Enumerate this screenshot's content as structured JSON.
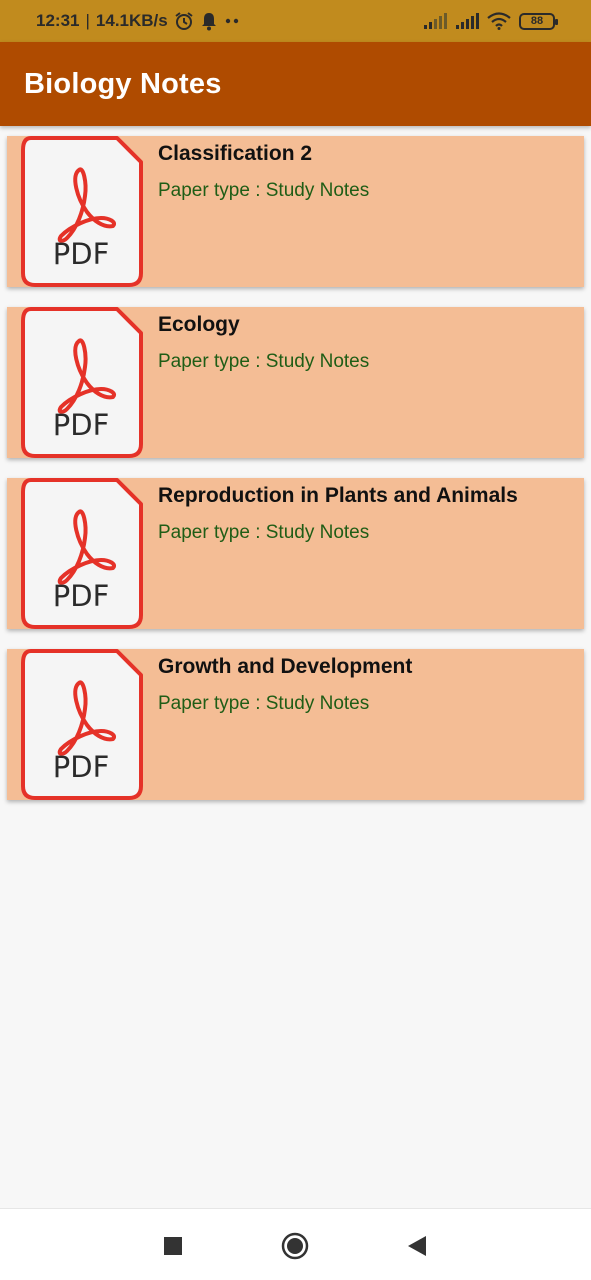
{
  "status_bar": {
    "time": "12:31",
    "separator": "|",
    "speed": "14.1KB/s",
    "battery": "88"
  },
  "app_bar": {
    "title": "Biology Notes"
  },
  "notes": [
    {
      "title": "Classification 2",
      "paper_label": "Paper type",
      "separator": ":",
      "paper_type": "Study Notes",
      "icon_text": "PDF"
    },
    {
      "title": "Ecology",
      "paper_label": "Paper type",
      "separator": ":",
      "paper_type": "Study Notes",
      "icon_text": "PDF"
    },
    {
      "title": "Reproduction in Plants and Animals",
      "paper_label": "Paper type",
      "separator": ":",
      "paper_type": "Study Notes",
      "icon_text": "PDF"
    },
    {
      "title": "Growth and Development",
      "paper_label": "Paper type",
      "separator": ":",
      "paper_type": "Study Notes",
      "icon_text": "PDF"
    }
  ],
  "icons": {
    "alarm": "alarm-icon",
    "notification": "bell-icon",
    "more": "more-dots-icon",
    "signal": "signal-icon",
    "wifi": "wifi-icon",
    "battery": "battery-icon",
    "pdf": "pdf-file-icon",
    "recents": "square-icon",
    "home": "circle-icon",
    "back": "triangle-back-icon"
  },
  "colors": {
    "status_bar": "#c18b1e",
    "app_bar": "#af4b00",
    "card": "#f4bd95",
    "subtitle": "#1f5d16",
    "pdf_red": "#e53228"
  }
}
